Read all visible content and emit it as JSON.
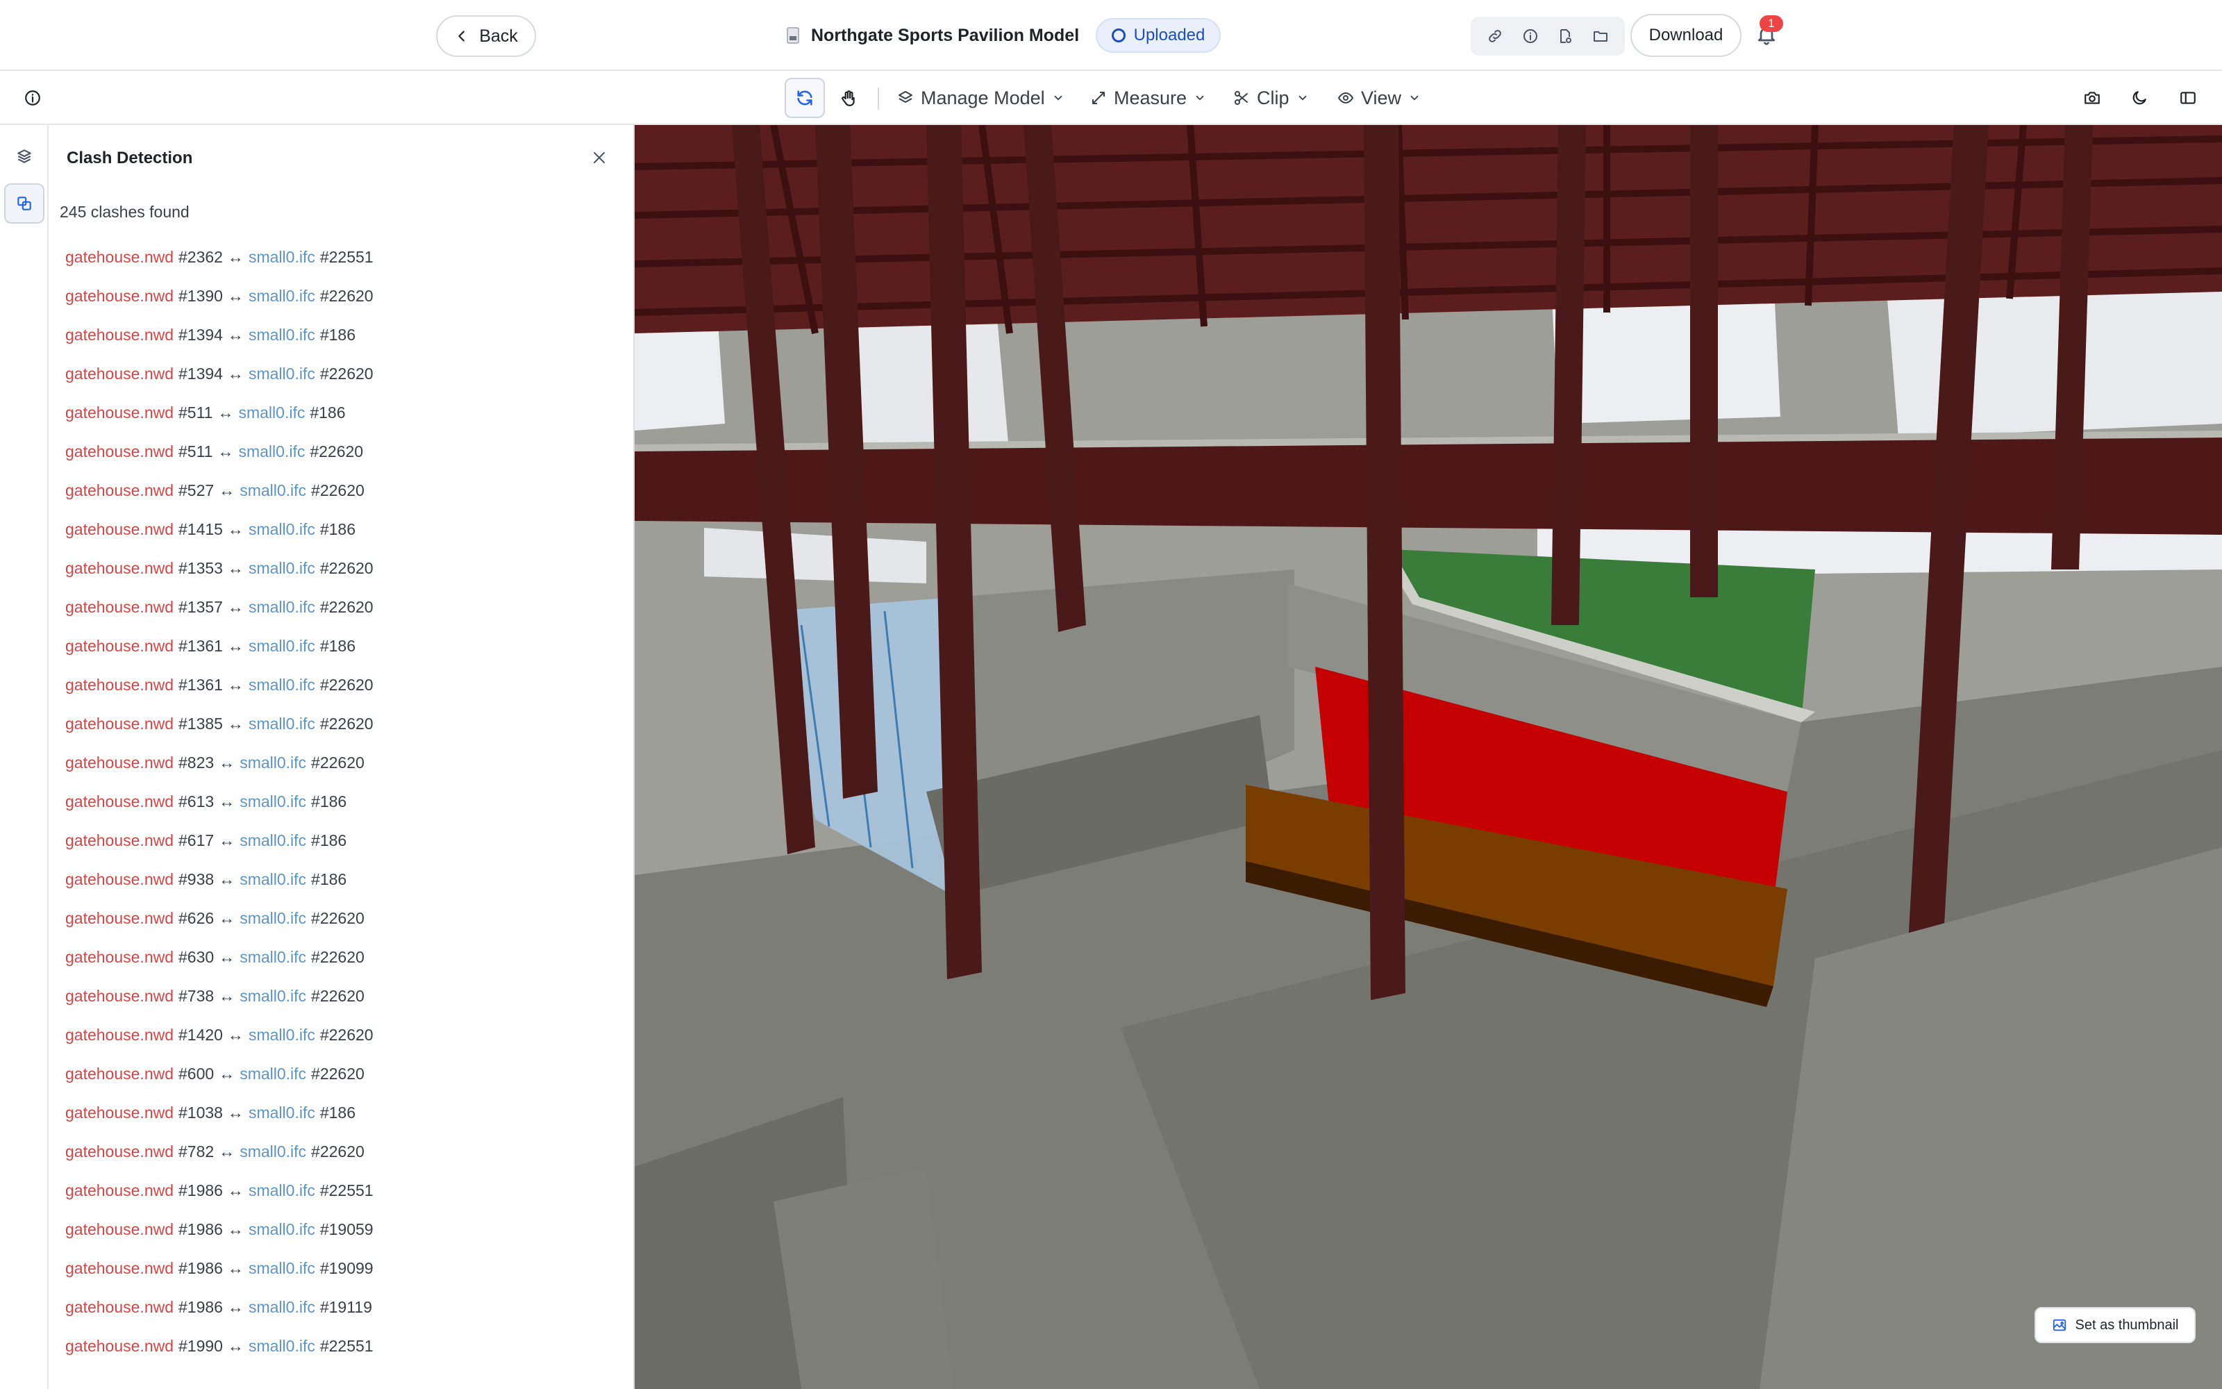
{
  "header": {
    "back_label": "Back",
    "model_title": "Northgate Sports Pavilion Model",
    "status": "Uploaded",
    "download_label": "Download",
    "notification_count": "1",
    "accent_color": "#1e4fb8",
    "header_icons": [
      "link-icon",
      "info-icon",
      "share-icon",
      "folder-icon"
    ]
  },
  "toolbar": {
    "menus": {
      "manage_model": "Manage Model",
      "measure": "Measure",
      "clip": "Clip",
      "view": "View"
    },
    "left_icons": [
      "info-icon"
    ],
    "tool_icons": [
      "sync-icon",
      "hand-icon"
    ],
    "right_icons": [
      "camera-icon",
      "moon-icon",
      "sidebar-toggle-icon"
    ]
  },
  "rail": {
    "items": [
      "layers-icon",
      "clash-detection-icon"
    ],
    "active": "clash-detection-icon"
  },
  "panel": {
    "title": "Clash Detection",
    "count_text": "245 clashes found",
    "arrow": "↔",
    "colors": {
      "file_a": "#d64545",
      "file_b": "#5e94c4"
    },
    "clashes": [
      {
        "file_a": "gatehouse.nwd",
        "id_a": "#2362",
        "file_b": "small0.ifc",
        "id_b": "#22551"
      },
      {
        "file_a": "gatehouse.nwd",
        "id_a": "#1390",
        "file_b": "small0.ifc",
        "id_b": "#22620"
      },
      {
        "file_a": "gatehouse.nwd",
        "id_a": "#1394",
        "file_b": "small0.ifc",
        "id_b": "#186"
      },
      {
        "file_a": "gatehouse.nwd",
        "id_a": "#1394",
        "file_b": "small0.ifc",
        "id_b": "#22620"
      },
      {
        "file_a": "gatehouse.nwd",
        "id_a": "#511",
        "file_b": "small0.ifc",
        "id_b": "#186"
      },
      {
        "file_a": "gatehouse.nwd",
        "id_a": "#511",
        "file_b": "small0.ifc",
        "id_b": "#22620"
      },
      {
        "file_a": "gatehouse.nwd",
        "id_a": "#527",
        "file_b": "small0.ifc",
        "id_b": "#22620"
      },
      {
        "file_a": "gatehouse.nwd",
        "id_a": "#1415",
        "file_b": "small0.ifc",
        "id_b": "#186"
      },
      {
        "file_a": "gatehouse.nwd",
        "id_a": "#1353",
        "file_b": "small0.ifc",
        "id_b": "#22620"
      },
      {
        "file_a": "gatehouse.nwd",
        "id_a": "#1357",
        "file_b": "small0.ifc",
        "id_b": "#22620"
      },
      {
        "file_a": "gatehouse.nwd",
        "id_a": "#1361",
        "file_b": "small0.ifc",
        "id_b": "#186"
      },
      {
        "file_a": "gatehouse.nwd",
        "id_a": "#1361",
        "file_b": "small0.ifc",
        "id_b": "#22620"
      },
      {
        "file_a": "gatehouse.nwd",
        "id_a": "#1385",
        "file_b": "small0.ifc",
        "id_b": "#22620"
      },
      {
        "file_a": "gatehouse.nwd",
        "id_a": "#823",
        "file_b": "small0.ifc",
        "id_b": "#22620"
      },
      {
        "file_a": "gatehouse.nwd",
        "id_a": "#613",
        "file_b": "small0.ifc",
        "id_b": "#186"
      },
      {
        "file_a": "gatehouse.nwd",
        "id_a": "#617",
        "file_b": "small0.ifc",
        "id_b": "#186"
      },
      {
        "file_a": "gatehouse.nwd",
        "id_a": "#938",
        "file_b": "small0.ifc",
        "id_b": "#186"
      },
      {
        "file_a": "gatehouse.nwd",
        "id_a": "#626",
        "file_b": "small0.ifc",
        "id_b": "#22620"
      },
      {
        "file_a": "gatehouse.nwd",
        "id_a": "#630",
        "file_b": "small0.ifc",
        "id_b": "#22620"
      },
      {
        "file_a": "gatehouse.nwd",
        "id_a": "#738",
        "file_b": "small0.ifc",
        "id_b": "#22620"
      },
      {
        "file_a": "gatehouse.nwd",
        "id_a": "#1420",
        "file_b": "small0.ifc",
        "id_b": "#22620"
      },
      {
        "file_a": "gatehouse.nwd",
        "id_a": "#600",
        "file_b": "small0.ifc",
        "id_b": "#22620"
      },
      {
        "file_a": "gatehouse.nwd",
        "id_a": "#1038",
        "file_b": "small0.ifc",
        "id_b": "#186"
      },
      {
        "file_a": "gatehouse.nwd",
        "id_a": "#782",
        "file_b": "small0.ifc",
        "id_b": "#22620"
      },
      {
        "file_a": "gatehouse.nwd",
        "id_a": "#1986",
        "file_b": "small0.ifc",
        "id_b": "#22551"
      },
      {
        "file_a": "gatehouse.nwd",
        "id_a": "#1986",
        "file_b": "small0.ifc",
        "id_b": "#19059"
      },
      {
        "file_a": "gatehouse.nwd",
        "id_a": "#1986",
        "file_b": "small0.ifc",
        "id_b": "#19099"
      },
      {
        "file_a": "gatehouse.nwd",
        "id_a": "#1986",
        "file_b": "small0.ifc",
        "id_b": "#19119"
      },
      {
        "file_a": "gatehouse.nwd",
        "id_a": "#1990",
        "file_b": "small0.ifc",
        "id_b": "#22551"
      }
    ]
  },
  "viewport": {
    "thumbnail_label": "Set as thumbnail",
    "colors": {
      "steel": "#4a1a1a",
      "roof_green": "#3a7d3a",
      "panel_red": "#c40000",
      "base_orange": "#7a3d00",
      "glass": "#a9c7df",
      "concrete": "#8b8b86"
    }
  }
}
